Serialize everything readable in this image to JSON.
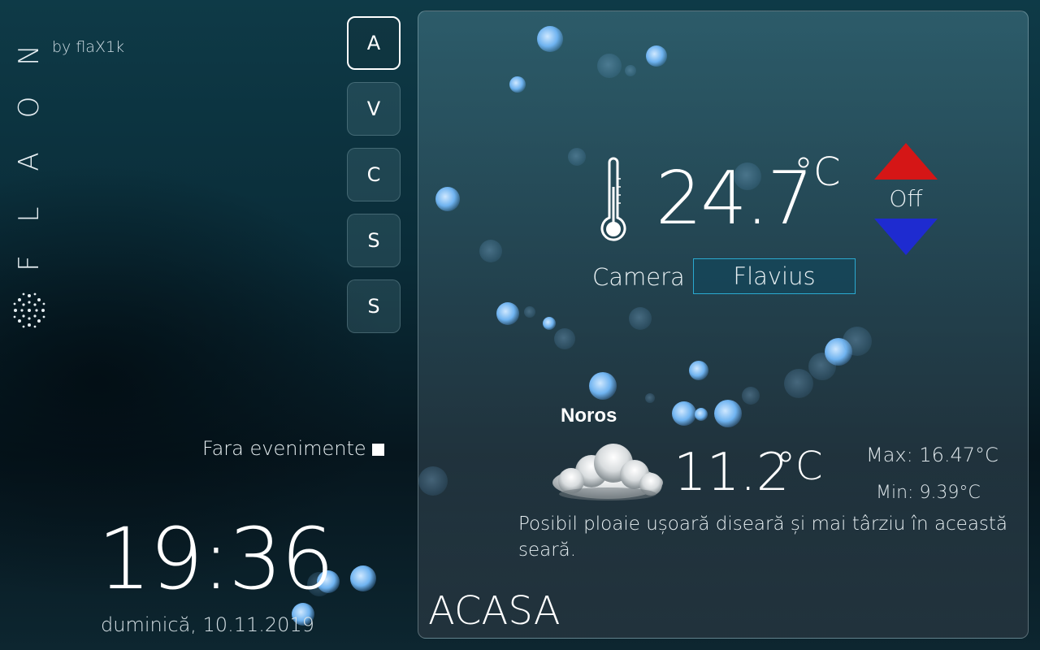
{
  "brand": {
    "letters": [
      "N",
      "O",
      "A",
      "L",
      "F"
    ],
    "byline": "by flaX1k"
  },
  "nav": [
    {
      "label": "A",
      "active": true
    },
    {
      "label": "V",
      "active": false
    },
    {
      "label": "C",
      "active": false
    },
    {
      "label": "S",
      "active": false
    },
    {
      "label": "S",
      "active": false
    }
  ],
  "events": {
    "text": "Fara evenimente"
  },
  "clock": {
    "time": "19:36",
    "date": "duminică, 10.11.2019"
  },
  "indoor": {
    "temperature": "24.7",
    "unit": "°C",
    "hvac_state": "Off",
    "room_label": "Camera",
    "room_selected": "Flavius",
    "colors": {
      "up": "#d51616",
      "down": "#1e2bd0",
      "select_border": "#2aa9d0"
    }
  },
  "weather": {
    "condition": "Noros",
    "temperature": "11.2",
    "unit": "°C",
    "max": "Max: 16.47°C",
    "min": "Min: 9.39°C",
    "forecast": "Posibil ploaie ușoară diseară și mai târziu în această seară.",
    "icon": "cloud-icon"
  },
  "location": "ACASA"
}
